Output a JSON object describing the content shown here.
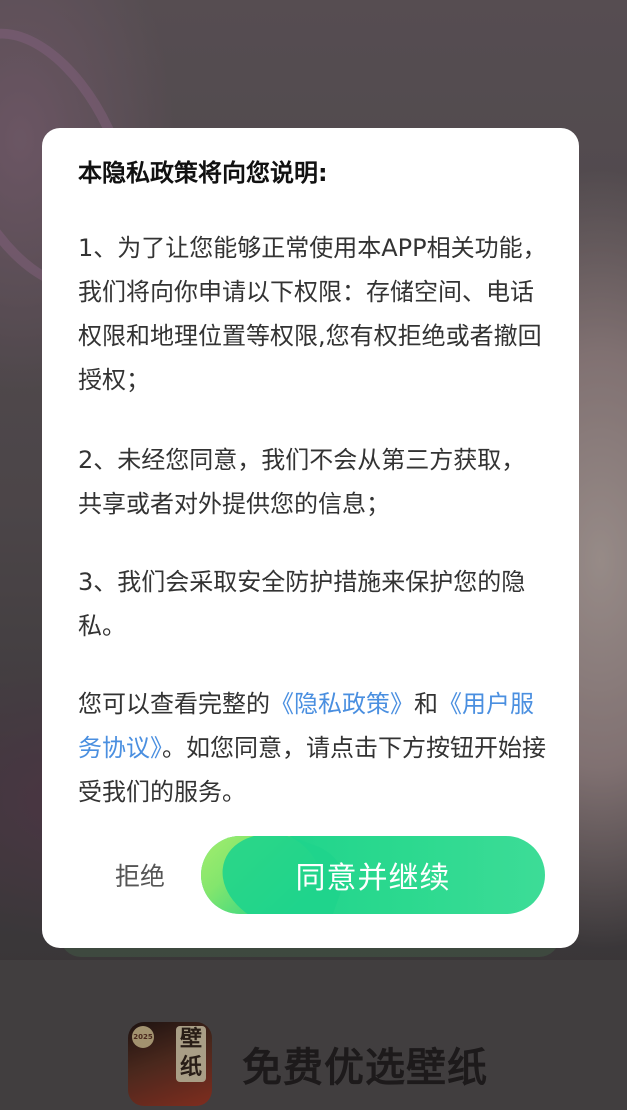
{
  "dialog": {
    "title": "本隐私政策将向您说明:",
    "para1": "1、为了让您能够正常使用本APP相关功能，我们将向你申请以下权限：存储空间、电话权限和地理位置等权限,您有权拒绝或者撤回授权；",
    "para2": "2、未经您同意，我们不会从第三方获取，共享或者对外提供您的信息；",
    "para3": "3、我们会采取安全防护措施来保护您的隐私。",
    "para4_prefix": "您可以查看完整的",
    "privacy_link": "《隐私政策》",
    "para4_and": "和",
    "service_link": "《用户服务协议》",
    "para4_suffix": "。如您同意，请点击下方按钮开始接受我们的服务。",
    "reject_label": "拒绝",
    "agree_label": "同意并继续"
  },
  "background": {
    "app_name": "免费优选壁纸",
    "app_icon_text": "壁纸",
    "app_icon_badge": "2025"
  },
  "colors": {
    "link": "#4a8fe0",
    "agree_button": "#19d18a",
    "dialog_bg": "#ffffff"
  }
}
